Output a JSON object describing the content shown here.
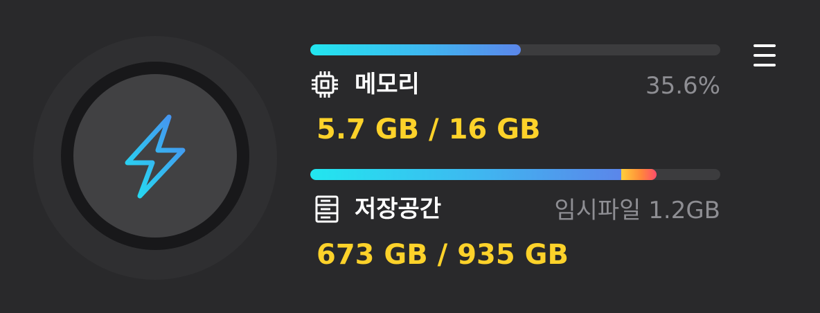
{
  "boost": {
    "icon": "lightning-bolt-icon",
    "icon_gradient": [
      "#4a8cf0",
      "#22dff0"
    ]
  },
  "memory": {
    "icon": "chip-icon",
    "label": "메모리",
    "percent_text": "35.6%",
    "usage_text": "5.7 GB / 16 GB",
    "usage_fraction": 0.513
  },
  "storage": {
    "icon": "storage-server-icon",
    "label": "저장공간",
    "temp_text": "임시파일 1.2GB",
    "usage_text": "673 GB / 935 GB",
    "used_fraction": 0.758,
    "temp_fraction": 0.086
  },
  "menu": {
    "icon": "hamburger-menu-icon"
  },
  "colors": {
    "background": "#29292b",
    "value_yellow": "#fdd22a",
    "secondary_gray": "#8e8e93",
    "bar_track": "#3c3c3e",
    "bar_gradient": [
      "#22e6ef",
      "#5b86ea"
    ],
    "temp_gradient": [
      "#ffcf3a",
      "#ff4d6a"
    ]
  }
}
